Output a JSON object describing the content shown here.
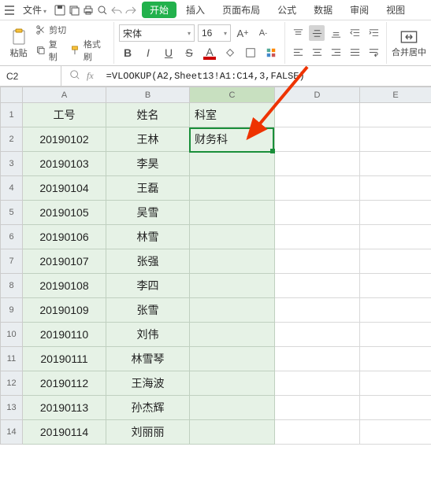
{
  "menubar": {
    "file_label": "文件",
    "icons": [
      "menu-icon",
      "save-icon",
      "print-icon",
      "preview-icon",
      "undo-icon",
      "redo-icon"
    ]
  },
  "tabs": {
    "items": [
      "开始",
      "插入",
      "页面布局",
      "公式",
      "数据",
      "审阅",
      "视图"
    ],
    "active_index": 0
  },
  "ribbon": {
    "paste_label": "粘贴",
    "cut_label": "剪切",
    "copy_label": "复制",
    "format_painter_label": "格式刷",
    "font_name": "宋体",
    "font_size": "16",
    "merge_label": "合并居中"
  },
  "cellref": "C2",
  "formula": "=VLOOKUP(A2,Sheet13!A1:C14,3,FALSE)",
  "columns": [
    "A",
    "B",
    "C",
    "D",
    "E"
  ],
  "selected_col": "C",
  "rows": [
    {
      "n": "1",
      "a": "工号",
      "b": "姓名",
      "c": "科室",
      "center_c": false,
      "header": true
    },
    {
      "n": "2",
      "a": "20190102",
      "b": "王林",
      "c": "财务科"
    },
    {
      "n": "3",
      "a": "20190103",
      "b": "李昊",
      "c": ""
    },
    {
      "n": "4",
      "a": "20190104",
      "b": "王磊",
      "c": ""
    },
    {
      "n": "5",
      "a": "20190105",
      "b": "吴雪",
      "c": ""
    },
    {
      "n": "6",
      "a": "20190106",
      "b": "林雪",
      "c": ""
    },
    {
      "n": "7",
      "a": "20190107",
      "b": "张强",
      "c": ""
    },
    {
      "n": "8",
      "a": "20190108",
      "b": "李四",
      "c": ""
    },
    {
      "n": "9",
      "a": "20190109",
      "b": "张雪",
      "c": ""
    },
    {
      "n": "10",
      "a": "20190110",
      "b": "刘伟",
      "c": ""
    },
    {
      "n": "11",
      "a": "20190111",
      "b": "林雪琴",
      "c": ""
    },
    {
      "n": "12",
      "a": "20190112",
      "b": "王海波",
      "c": ""
    },
    {
      "n": "13",
      "a": "20190113",
      "b": "孙杰辉",
      "c": ""
    },
    {
      "n": "14",
      "a": "20190114",
      "b": "刘丽丽",
      "c": ""
    }
  ],
  "selection": {
    "row": 2,
    "col": "C"
  }
}
